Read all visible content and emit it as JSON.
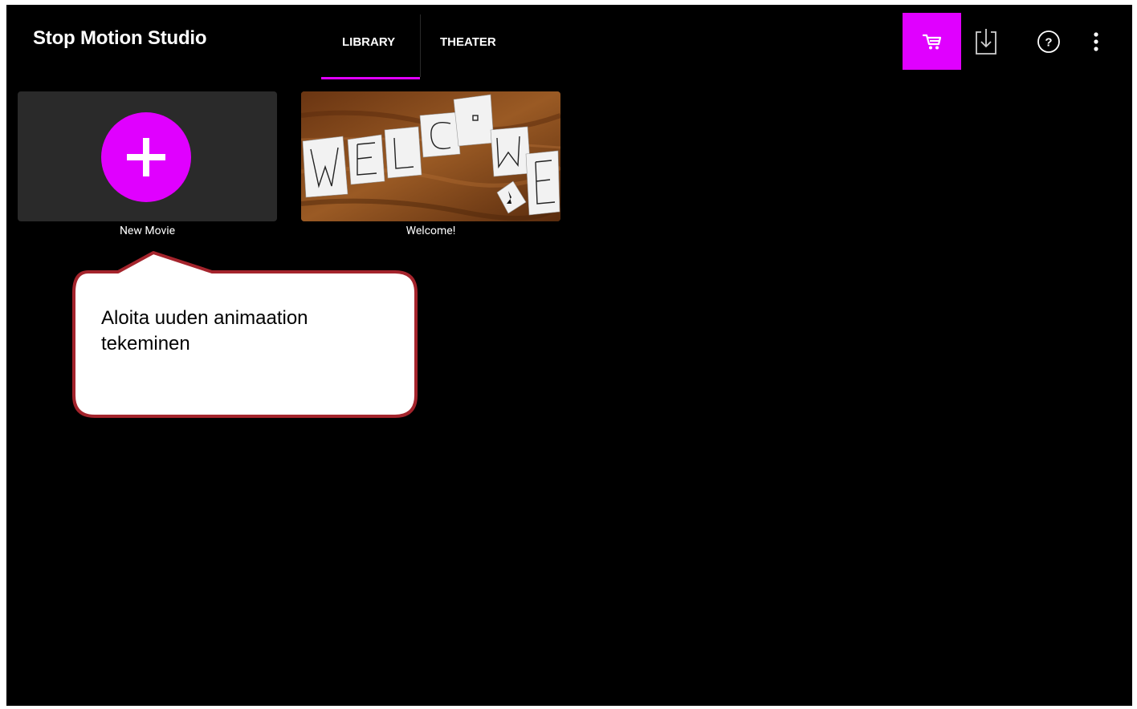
{
  "app": {
    "title": "Stop Motion Studio"
  },
  "tabs": [
    {
      "label": "LIBRARY",
      "active": true
    },
    {
      "label": "THEATER",
      "active": false
    }
  ],
  "toolbar": {
    "cart_icon": "shopping-cart-icon",
    "download_icon": "download-icon",
    "help_icon": "help-circle-icon",
    "more_icon": "more-vertical-icon"
  },
  "library": {
    "items": [
      {
        "label": "New Movie",
        "icon": "plus-icon"
      },
      {
        "label": "Welcome!"
      }
    ]
  },
  "callout": {
    "text": "Aloita uuden animaation tekeminen"
  },
  "colors": {
    "accent": "#e000ff",
    "background": "#000000",
    "card": "#2a2a2a",
    "callout_border": "#a4242c"
  }
}
